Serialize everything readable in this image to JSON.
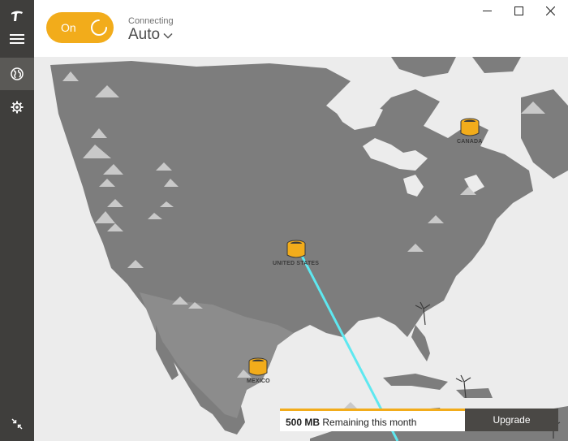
{
  "header": {
    "toggle_label": "On",
    "status": "Connecting",
    "mode": "Auto"
  },
  "sidebar": {
    "items": [
      {
        "icon": "tunnelbear-logo-icon"
      },
      {
        "icon": "hamburger-menu-icon"
      },
      {
        "icon": "globe-icon"
      },
      {
        "icon": "gear-icon"
      },
      {
        "icon": "collapse-icon"
      }
    ]
  },
  "map": {
    "countries": [
      {
        "label": "CANADA"
      },
      {
        "label": "UNITED STATES"
      },
      {
        "label": "MEXICO"
      }
    ]
  },
  "data_bar": {
    "amount": "500 MB",
    "text": "Remaining this month",
    "upgrade_label": "Upgrade"
  },
  "colors": {
    "accent": "#f2ac1b",
    "sidebar": "#3f3e3c",
    "land": "#7d7d7d",
    "route": "#5ee8f0"
  }
}
